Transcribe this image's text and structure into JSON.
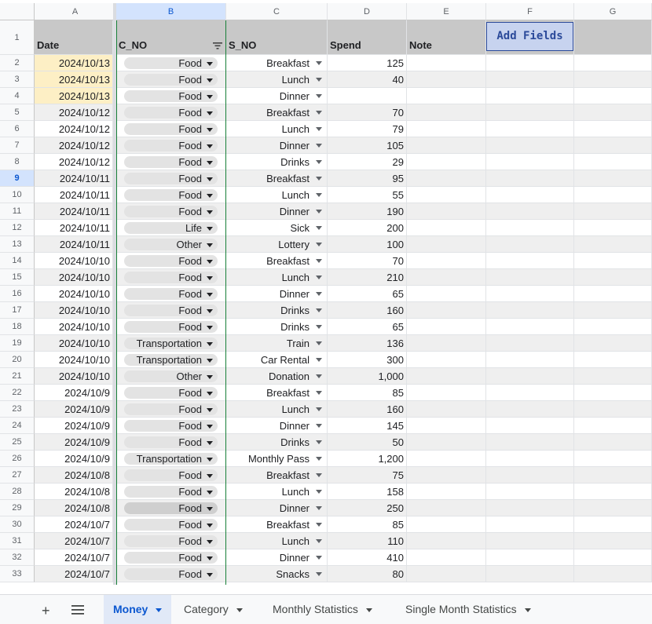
{
  "columns": [
    "A",
    "B",
    "C",
    "D",
    "E",
    "F",
    "G"
  ],
  "selected_column": "B",
  "selected_row": 9,
  "header_row": {
    "row_number": 1,
    "date": "Date",
    "c_no": "C_NO",
    "s_no": "S_NO",
    "spend": "Spend",
    "note": "Note"
  },
  "add_fields_button": "Add Fields",
  "highlight_color": "#fdefc5",
  "rows": [
    {
      "num": 2,
      "date": "2024/10/13",
      "cat": "Food",
      "sub": "Breakfast",
      "spend": "125",
      "hl": true
    },
    {
      "num": 3,
      "date": "2024/10/13",
      "cat": "Food",
      "sub": "Lunch",
      "spend": "40",
      "hl": true
    },
    {
      "num": 4,
      "date": "2024/10/13",
      "cat": "Food",
      "sub": "Dinner",
      "spend": "",
      "hl": true
    },
    {
      "num": 5,
      "date": "2024/10/12",
      "cat": "Food",
      "sub": "Breakfast",
      "spend": "70"
    },
    {
      "num": 6,
      "date": "2024/10/12",
      "cat": "Food",
      "sub": "Lunch",
      "spend": "79"
    },
    {
      "num": 7,
      "date": "2024/10/12",
      "cat": "Food",
      "sub": "Dinner",
      "spend": "105"
    },
    {
      "num": 8,
      "date": "2024/10/12",
      "cat": "Food",
      "sub": "Drinks",
      "spend": "29"
    },
    {
      "num": 9,
      "date": "2024/10/11",
      "cat": "Food",
      "sub": "Breakfast",
      "spend": "95"
    },
    {
      "num": 10,
      "date": "2024/10/11",
      "cat": "Food",
      "sub": "Lunch",
      "spend": "55"
    },
    {
      "num": 11,
      "date": "2024/10/11",
      "cat": "Food",
      "sub": "Dinner",
      "spend": "190"
    },
    {
      "num": 12,
      "date": "2024/10/11",
      "cat": "Life",
      "sub": "Sick",
      "spend": "200"
    },
    {
      "num": 13,
      "date": "2024/10/11",
      "cat": "Other",
      "sub": "Lottery",
      "spend": "100"
    },
    {
      "num": 14,
      "date": "2024/10/10",
      "cat": "Food",
      "sub": "Breakfast",
      "spend": "70"
    },
    {
      "num": 15,
      "date": "2024/10/10",
      "cat": "Food",
      "sub": "Lunch",
      "spend": "210"
    },
    {
      "num": 16,
      "date": "2024/10/10",
      "cat": "Food",
      "sub": "Dinner",
      "spend": "65"
    },
    {
      "num": 17,
      "date": "2024/10/10",
      "cat": "Food",
      "sub": "Drinks",
      "spend": "160"
    },
    {
      "num": 18,
      "date": "2024/10/10",
      "cat": "Food",
      "sub": "Drinks",
      "spend": "65"
    },
    {
      "num": 19,
      "date": "2024/10/10",
      "cat": "Transportation",
      "sub": "Train",
      "spend": "136"
    },
    {
      "num": 20,
      "date": "2024/10/10",
      "cat": "Transportation",
      "sub": "Car Rental",
      "spend": "300"
    },
    {
      "num": 21,
      "date": "2024/10/10",
      "cat": "Other",
      "sub": "Donation",
      "spend": "1,000"
    },
    {
      "num": 22,
      "date": "2024/10/9",
      "cat": "Food",
      "sub": "Breakfast",
      "spend": "85"
    },
    {
      "num": 23,
      "date": "2024/10/9",
      "cat": "Food",
      "sub": "Lunch",
      "spend": "160"
    },
    {
      "num": 24,
      "date": "2024/10/9",
      "cat": "Food",
      "sub": "Dinner",
      "spend": "145"
    },
    {
      "num": 25,
      "date": "2024/10/9",
      "cat": "Food",
      "sub": "Drinks",
      "spend": "50"
    },
    {
      "num": 26,
      "date": "2024/10/9",
      "cat": "Transportation",
      "sub": "Monthly Pass",
      "spend": "1,200"
    },
    {
      "num": 27,
      "date": "2024/10/8",
      "cat": "Food",
      "sub": "Breakfast",
      "spend": "75"
    },
    {
      "num": 28,
      "date": "2024/10/8",
      "cat": "Food",
      "sub": "Lunch",
      "spend": "158"
    },
    {
      "num": 29,
      "date": "2024/10/8",
      "cat": "Food",
      "sub": "Dinner",
      "spend": "250",
      "active_chip": true
    },
    {
      "num": 30,
      "date": "2024/10/7",
      "cat": "Food",
      "sub": "Breakfast",
      "spend": "85"
    },
    {
      "num": 31,
      "date": "2024/10/7",
      "cat": "Food",
      "sub": "Lunch",
      "spend": "110"
    },
    {
      "num": 32,
      "date": "2024/10/7",
      "cat": "Food",
      "sub": "Dinner",
      "spend": "410"
    },
    {
      "num": 33,
      "date": "2024/10/7",
      "cat": "Food",
      "sub": "Snacks",
      "spend": "80"
    }
  ],
  "sheet_tabs": [
    {
      "label": "Money",
      "active": true
    },
    {
      "label": "Category",
      "active": false
    },
    {
      "label": "Monthly Statistics",
      "active": false
    },
    {
      "label": "Single Month Statistics",
      "active": false
    }
  ],
  "toolbar_icons": [
    "add-sheet-icon",
    "all-sheets-menu-icon"
  ]
}
